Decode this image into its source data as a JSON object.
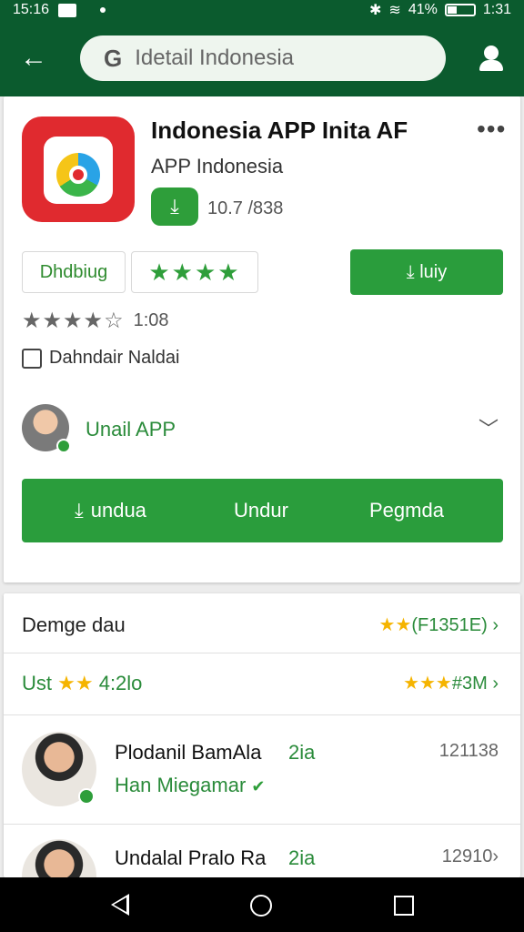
{
  "status_bar": {
    "time": "15:16",
    "battery": "41%",
    "clock_right": "1:31"
  },
  "search": {
    "placeholder": "Idetail Indonesia"
  },
  "app": {
    "title": "Indonesia APP Inita AF",
    "publisher": "APP Indonesia",
    "download_count": "10.7 /838",
    "chip1_label": "Dhdbiug",
    "chip2_stars": "★★★★",
    "install_label": "luiy",
    "rating_stars": "★★★★☆",
    "rating_value": "1:08",
    "info_text": "Dahndair Naldai",
    "developer_name": "Unail APP",
    "actions": {
      "a1": "undua",
      "a2": "Undur",
      "a3": "Pegmda"
    }
  },
  "reviews_section": {
    "row1_label": "Demge dau",
    "row1_stars": "★★",
    "row1_value": "(F1351E)",
    "row2_label": "Ust",
    "row2_stars_left": "★★",
    "row2_value_left": "4:2lo",
    "row2_stars_right": "★★★",
    "row2_value_right": "#3M",
    "reviews": [
      {
        "name": "Plodanil BamAla",
        "tag": "2ia",
        "date": "121138",
        "sub": "Han Miegamar"
      },
      {
        "name": "Undalal Pralo Ra",
        "tag": "2ia",
        "date": "12910"
      }
    ]
  },
  "colors": {
    "brand_green": "#0b5b2e",
    "action_green": "#2a9d3c",
    "star_yellow": "#f5b400"
  },
  "icons": [
    "back-arrow-icon",
    "google-g-icon",
    "account-icon",
    "more-icon",
    "download-icon",
    "checkbox-icon",
    "chevron-down-icon",
    "chevron-right-icon",
    "verified-icon",
    "nav-back-icon",
    "nav-home-icon",
    "nav-recent-icon"
  ]
}
